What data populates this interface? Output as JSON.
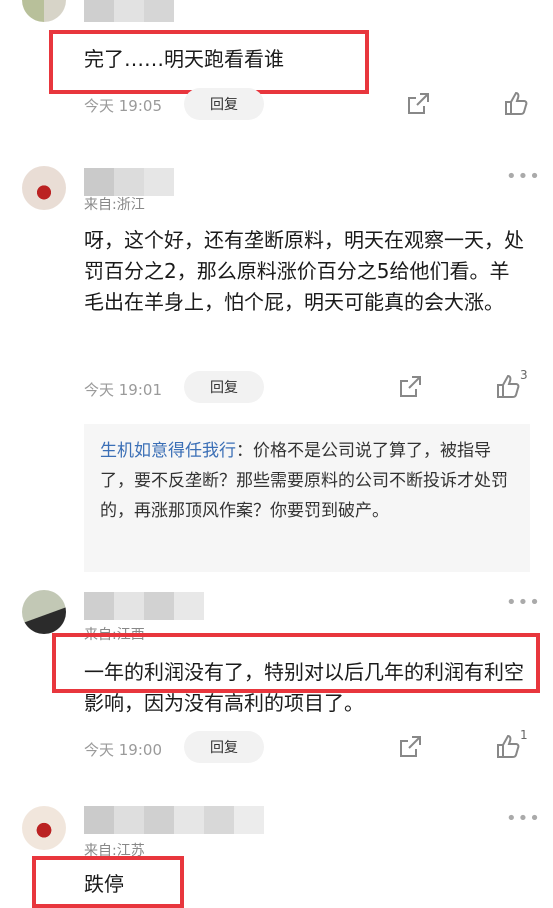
{
  "comments": [
    {
      "text": "完了……明天跑看看谁",
      "time": "今天 19:05",
      "reply_label": "回复"
    },
    {
      "location": "来自:浙江",
      "text": "呀，这个好，还有垄断原料，明天在观察一天，处罚百分之2，那么原料涨价百分之5给他们看。羊毛出在羊身上，怕个屁，明天可能真的会大涨。",
      "time": "今天 19:01",
      "reply_label": "回复",
      "like_count": "3",
      "sub_reply": {
        "author": "生机如意得任我行",
        "text": "：价格不是公司说了算了，被指导了，要不反垄断？那些需要原料的公司不断投诉才处罚的，再涨那顶风作案？你要罚到破产。"
      }
    },
    {
      "location": "来自:江西",
      "text": "一年的利润没有了，特别对以后几年的利润有利空影响，因为没有高利的项目了。",
      "time": "今天 19:00",
      "reply_label": "回复",
      "like_count": "1"
    },
    {
      "location": "来自:江苏",
      "text": "跌停"
    }
  ],
  "icons": {
    "share": "share-icon",
    "like": "thumbs-up-icon",
    "more": "more-icon"
  },
  "colors": {
    "highlight": "#e8363d",
    "subreply_author": "#3b6fb6"
  }
}
